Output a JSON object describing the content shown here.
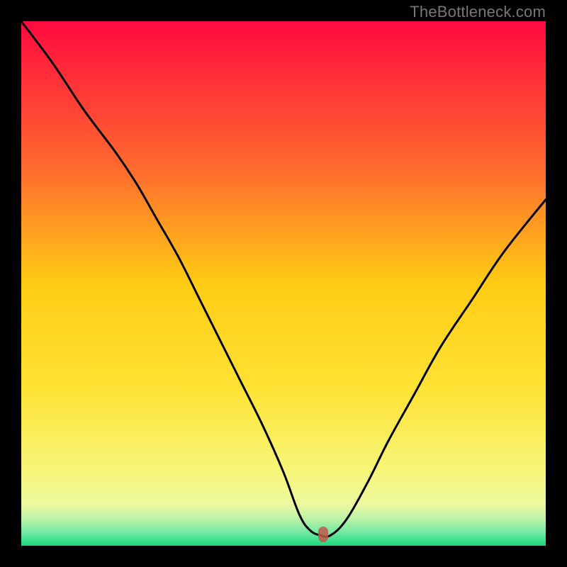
{
  "watermark": "TheBottleneck.com",
  "colors": {
    "frame": "#000000",
    "gradient_stops": [
      {
        "pos": 0.0,
        "color": "#ff0a3f"
      },
      {
        "pos": 0.28,
        "color": "#ff6a2e"
      },
      {
        "pos": 0.5,
        "color": "#ffcc14"
      },
      {
        "pos": 0.7,
        "color": "#ffe235"
      },
      {
        "pos": 0.86,
        "color": "#f6f67a"
      },
      {
        "pos": 0.92,
        "color": "#eef9a0"
      },
      {
        "pos": 0.95,
        "color": "#b9f2a7"
      },
      {
        "pos": 0.975,
        "color": "#72e9a3"
      },
      {
        "pos": 1.0,
        "color": "#18d979"
      }
    ],
    "curve": "#000000",
    "marker": "#c1584b"
  },
  "marker": {
    "x_frac": 0.576,
    "y_frac": 0.978
  },
  "chart_data": {
    "type": "line",
    "title": "",
    "xlabel": "",
    "ylabel": "",
    "xlim": [
      0,
      100
    ],
    "ylim": [
      0,
      100
    ],
    "grid": false,
    "legend": false,
    "series": [
      {
        "name": "bottleneck-curve",
        "x": [
          0,
          6,
          12,
          18,
          22,
          26,
          30,
          34,
          38,
          42,
          46,
          50,
          53,
          55,
          57,
          59,
          62,
          66,
          70,
          75,
          80,
          86,
          92,
          100
        ],
        "y": [
          100,
          92,
          83,
          75,
          69,
          62,
          55,
          47,
          39,
          31,
          23,
          14,
          6,
          3,
          2,
          2,
          5,
          12,
          20,
          29,
          38,
          47,
          56,
          66
        ]
      }
    ],
    "annotations": [
      {
        "type": "marker",
        "x": 57.6,
        "y": 2.2,
        "label": ""
      }
    ]
  }
}
